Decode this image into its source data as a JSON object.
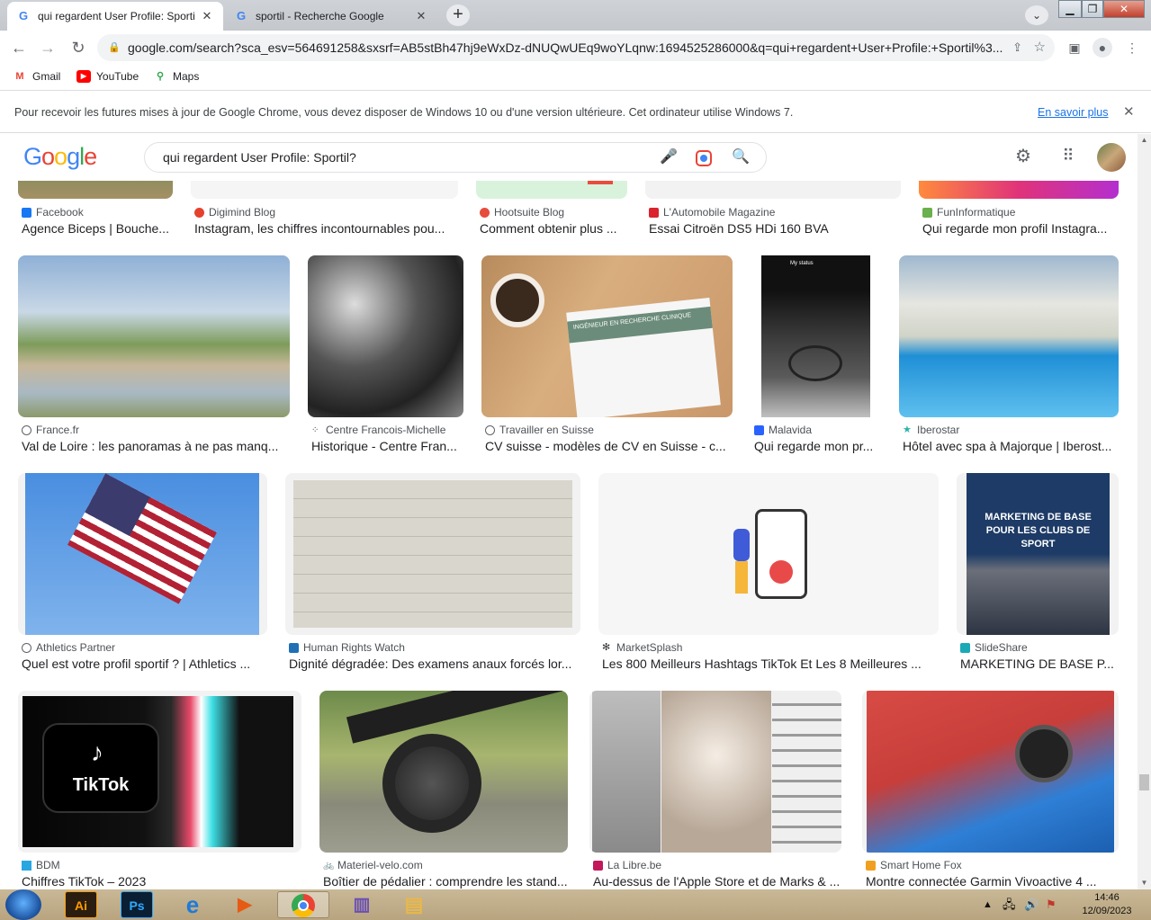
{
  "tabs": [
    {
      "title": "qui regardent User Profile: Sporti"
    },
    {
      "title": "sportil - Recherche Google"
    }
  ],
  "url": "google.com/search?sca_esv=564691258&sxsrf=AB5stBh47hj9eWxDz-dNUQwUEq9woYLqnw:1694525286000&q=qui+regardent+User+Profile:+Sportil%3...",
  "bookmarks": [
    {
      "label": "Gmail"
    },
    {
      "label": "YouTube"
    },
    {
      "label": "Maps"
    }
  ],
  "infobar": {
    "message": "Pour recevoir les futures mises à jour de Google Chrome, vous devez disposer de Windows 10 ou d'une version ultérieure. Cet ordinateur utilise Windows 7.",
    "link": "En savoir plus"
  },
  "search": {
    "logo": "Google",
    "query": "qui regardent User Profile: Sportil?"
  },
  "results": [
    {
      "source": "Facebook",
      "title": "Agence Biceps | Bouche..."
    },
    {
      "source": "Digimind Blog",
      "title": "Instagram, les chiffres incontournables pou..."
    },
    {
      "source": "Hootsuite Blog",
      "title": "Comment obtenir plus ..."
    },
    {
      "source": "L'Automobile Magazine",
      "title": "Essai Citroën DS5 HDi 160 BVA"
    },
    {
      "source": "FunInformatique",
      "title": "Qui regarde mon profil Instagra..."
    },
    {
      "source": "France.fr",
      "title": "Val de Loire : les panoramas à ne pas manq..."
    },
    {
      "source": "Centre Francois-Michelle",
      "title": "Historique - Centre Fran..."
    },
    {
      "source": "Travailler en Suisse",
      "title": "CV suisse - modèles de CV en Suisse - c..."
    },
    {
      "source": "Malavida",
      "title": "Qui regarde mon pr..."
    },
    {
      "source": "Iberostar",
      "title": "Hôtel avec spa à Majorque | Iberost..."
    },
    {
      "source": "Athletics Partner",
      "title": "Quel est votre profil sportif ? | Athletics ..."
    },
    {
      "source": "Human Rights Watch",
      "title": "Dignité dégradée: Des examens anaux forcés lor..."
    },
    {
      "source": "MarketSplash",
      "title": "Les 800 Meilleurs Hashtags TikTok Et Les 8 Meilleures ..."
    },
    {
      "source": "SlideShare",
      "title": "MARKETING DE BASE P..."
    },
    {
      "source": "BDM",
      "title": "Chiffres TikTok – 2023"
    },
    {
      "source": "Materiel-velo.com",
      "title": "Boîtier de pédalier : comprendre les stand..."
    },
    {
      "source": "La Libre.be",
      "title": "Au-dessus de l'Apple Store et de Marks & ..."
    },
    {
      "source": "Smart Home Fox",
      "title": "Montre connectée Garmin Vivoactive 4 ..."
    }
  ],
  "image_text": {
    "mystatus": "My status",
    "resume": "INGÉNIEUR EN RECHERCHE CLINIQUE",
    "slide": "MARKETING DE BASE POUR LES CLUBS DE SPORT",
    "tiktok": "TikTok"
  },
  "taskbar": {
    "time": "14:46",
    "date": "12/09/2023",
    "apps": [
      "Ai",
      "Ps"
    ]
  }
}
